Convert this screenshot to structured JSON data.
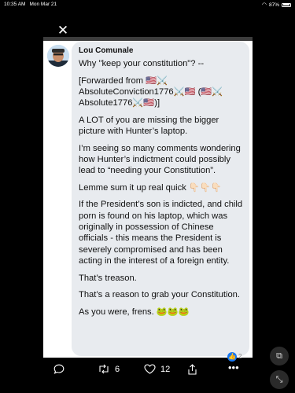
{
  "status_bar": {
    "time": "10:35 AM",
    "date": "Mon Mar 21",
    "battery": "87%"
  },
  "post": {
    "author": "Lou Comunale",
    "lines": [
      "Why \"keep your constitution\"? --",
      "[Forwarded from 🇺🇸⚔️ AbsoluteConviction1776⚔️🇺🇸 (🇺🇸⚔️ Absolute1776⚔️🇺🇸)]",
      "A LOT of you are missing the bigger picture with Hunter’s laptop.",
      "I’m seeing so many comments wondering how Hunter’s indictment could possibly lead to “needing your Constitution”.",
      "Lemme sum it up real quick 👇🏻👇🏻👇🏻",
      "If the President’s son is indicted, and child porn is found on his laptop, which was originally in possession of Chinese officials - this means the President is severely compromised and has been acting in the interest of a foreign entity.",
      "That’s treason.",
      "That’s a reason to grab your Constitution.",
      "As you were, frens. 🐸🐸🐸"
    ],
    "reaction_count": "2"
  },
  "toolbar": {
    "retweets": "6",
    "likes": "12"
  },
  "colors": {
    "background": "#000000",
    "bubble": "#e8ebef",
    "frame": "#3c3c3c"
  }
}
